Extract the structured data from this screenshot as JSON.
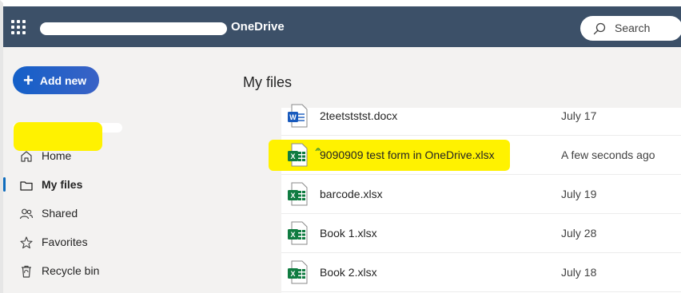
{
  "topbar": {
    "app_name": "OneDrive",
    "search_placeholder": "Search",
    "bar_color": "#3c5068"
  },
  "sidebar": {
    "add_new_label": "Add new",
    "items": [
      {
        "label": "Home",
        "icon": "home-icon"
      },
      {
        "label": "My files",
        "icon": "folder-icon",
        "active": true
      },
      {
        "label": "Shared",
        "icon": "people-icon"
      },
      {
        "label": "Favorites",
        "icon": "star-icon"
      },
      {
        "label": "Recycle bin",
        "icon": "recycle-bin-icon"
      }
    ]
  },
  "main": {
    "title": "My files",
    "files": [
      {
        "name": "2teetststst.docx",
        "modified": "July 17",
        "type": "word-icon"
      },
      {
        "name": "9090909 test form in OneDrive.xlsx",
        "modified": "A few seconds ago",
        "type": "excel-icon"
      },
      {
        "name": "barcode.xlsx",
        "modified": "July 19",
        "type": "excel-icon"
      },
      {
        "name": "Book 1.xlsx",
        "modified": "July 28",
        "type": "excel-icon"
      },
      {
        "name": "Book 2.xlsx",
        "modified": "July 18",
        "type": "excel-icon"
      }
    ]
  },
  "colors": {
    "accent": "#0f6cbd",
    "highlight": "#fff200",
    "excel_green": "#107c41",
    "word_blue": "#185abd"
  }
}
